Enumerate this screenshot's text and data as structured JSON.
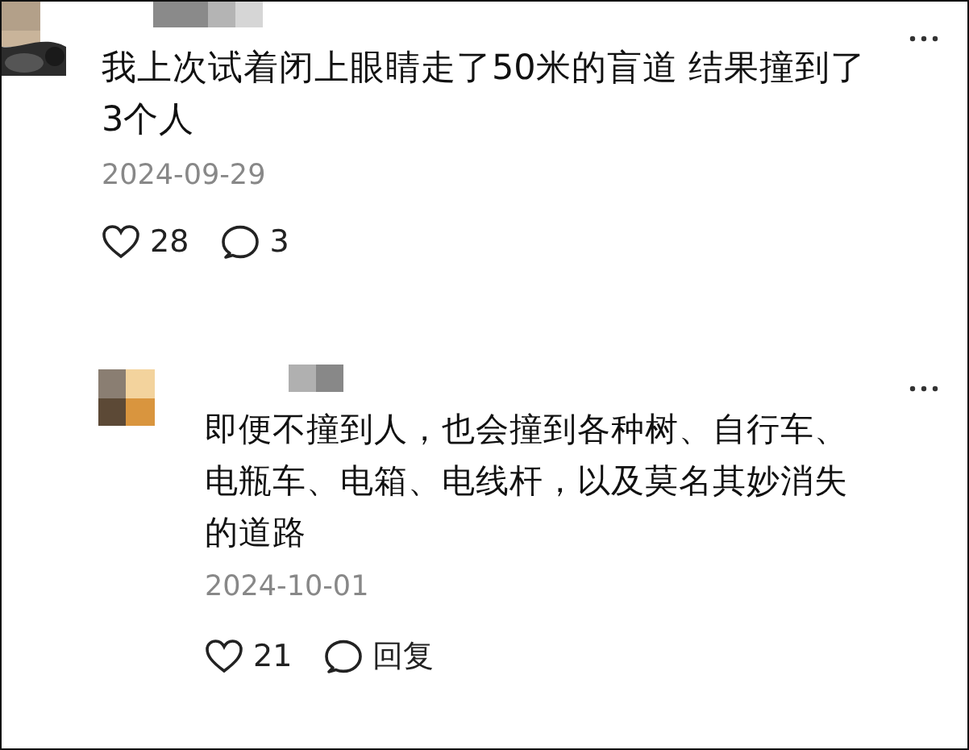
{
  "comments": [
    {
      "kind": "comment",
      "text": "我上次试着闭上眼睛走了50米的盲道 结果撞到了3个人",
      "date": "2024-09-29",
      "likes": "28",
      "comments": "3"
    },
    {
      "kind": "reply",
      "text": "即便不撞到人，也会撞到各种树、自行车、电瓶车、电箱、电线杆，以及莫名其妙消失的道路",
      "date": "2024-10-01",
      "likes": "21",
      "reply_label": "回复"
    }
  ]
}
